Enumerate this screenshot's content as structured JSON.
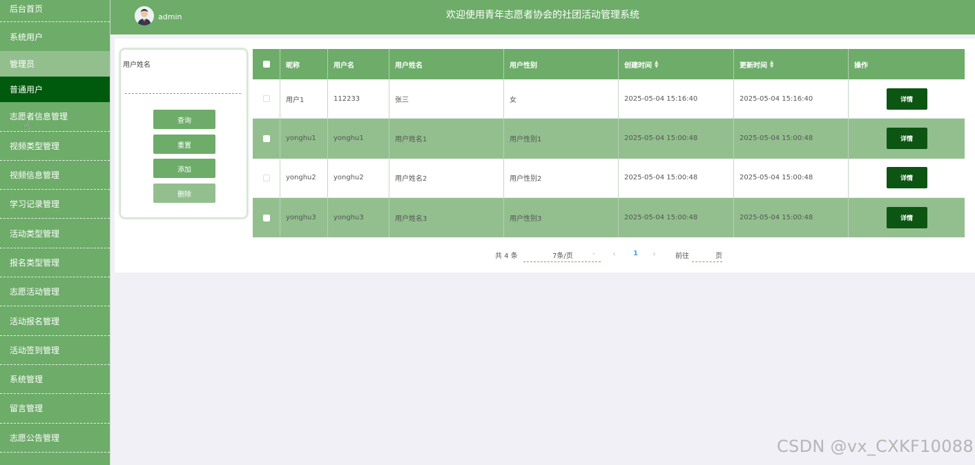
{
  "header": {
    "admin_name": "admin",
    "system_title": "欢迎使用青年志愿者协会的社团活动管理系统"
  },
  "sidebar": {
    "items": [
      {
        "label": "后台首页"
      },
      {
        "label": "系统用户"
      },
      {
        "label": "管理员"
      },
      {
        "label": "普通用户"
      },
      {
        "label": "志愿者信息管理"
      },
      {
        "label": "视频类型管理"
      },
      {
        "label": "视频信息管理"
      },
      {
        "label": "学习记录管理"
      },
      {
        "label": "活动类型管理"
      },
      {
        "label": "报名类型管理"
      },
      {
        "label": "志愿活动管理"
      },
      {
        "label": "活动报名管理"
      },
      {
        "label": "活动签到管理"
      },
      {
        "label": "系统管理"
      },
      {
        "label": "留言管理"
      },
      {
        "label": "志愿公告管理"
      }
    ]
  },
  "search": {
    "label": "用户姓名",
    "value": "",
    "buttons": {
      "query": "查询",
      "reset": "重置",
      "add": "添加",
      "delete": "删除"
    }
  },
  "table": {
    "columns": [
      "昵称",
      "用户名",
      "用户姓名",
      "用户性别",
      "创建时间",
      "更新时间",
      "操作"
    ],
    "rows": [
      {
        "nickname": "用户1",
        "username": "112233",
        "realname": "张三",
        "gender": "女",
        "created": "2025-05-04 15:16:40",
        "updated": "2025-05-04 15:16:40",
        "action": "详情"
      },
      {
        "nickname": "yonghu1",
        "username": "yonghu1",
        "realname": "用户姓名1",
        "gender": "用户性别1",
        "created": "2025-05-04 15:00:48",
        "updated": "2025-05-04 15:00:48",
        "action": "详情"
      },
      {
        "nickname": "yonghu2",
        "username": "yonghu2",
        "realname": "用户姓名2",
        "gender": "用户性别2",
        "created": "2025-05-04 15:00:48",
        "updated": "2025-05-04 15:00:48",
        "action": "详情"
      },
      {
        "nickname": "yonghu3",
        "username": "yonghu3",
        "realname": "用户姓名3",
        "gender": "用户性别3",
        "created": "2025-05-04 15:00:48",
        "updated": "2025-05-04 15:00:48",
        "action": "详情"
      }
    ]
  },
  "pagination": {
    "total_text": "共 4 条",
    "page_size": "7条/页",
    "current_page": "1",
    "goto_label": "前往",
    "page_label": "页"
  },
  "watermark": "CSDN @vx_CXKF10088",
  "colors": {
    "primary": "#6dac69",
    "light_row": "#93bf8f",
    "active_sidebar": "#005a0d",
    "detail_button": "#0d5512"
  },
  "icons": {
    "sort": "sort-icon",
    "cursor": "hand-cursor-icon",
    "avatar": "user-avatar"
  }
}
